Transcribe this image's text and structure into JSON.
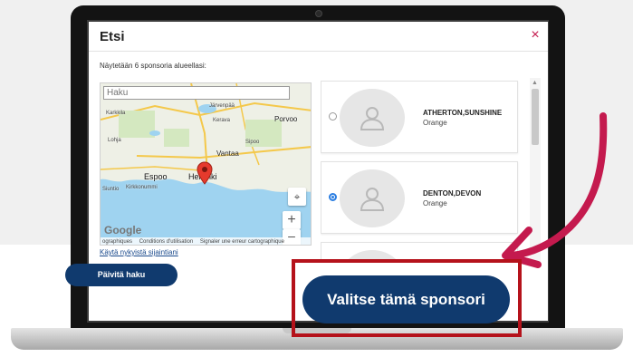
{
  "modal": {
    "title": "Etsi",
    "close_label": "×",
    "subtitle": "Näytetään 6 sponsoria alueellasi:"
  },
  "map": {
    "search_placeholder": "Haku",
    "places": {
      "helsinki": "Helsinki",
      "espoo": "Espoo",
      "vantaa": "Vantaa",
      "porvoo": "Porvoo",
      "kirkkonummi": "Kirkkonummi",
      "jarvenpaa": "Järvenpää",
      "kerava": "Kerava",
      "sipoo": "Sipoo",
      "siuntio": "Siuntio",
      "lohja": "Lohja",
      "karkkila": "Karkkila"
    },
    "zoom_in": "+",
    "zoom_out": "−",
    "locate_icon": "⌖",
    "google_logo": "Google",
    "footer": [
      "ographiques",
      "Conditions d'utilisation",
      "Signaler une erreur cartographique"
    ]
  },
  "use_location_label": "Käytä nykyistä sijaintiani",
  "sponsors": [
    {
      "name": "ATHERTON,SUNSHINE",
      "color": "Orange",
      "selected": false
    },
    {
      "name": "DENTON,DEVON",
      "color": "Orange",
      "selected": true
    }
  ],
  "buttons": {
    "update": "Päivitä haku",
    "select_sponsor": "Valitse tämä sponsori"
  },
  "colors": {
    "primary": "#103a6e",
    "accent_red": "#b5121b",
    "arrow_red": "#c41a4e"
  }
}
